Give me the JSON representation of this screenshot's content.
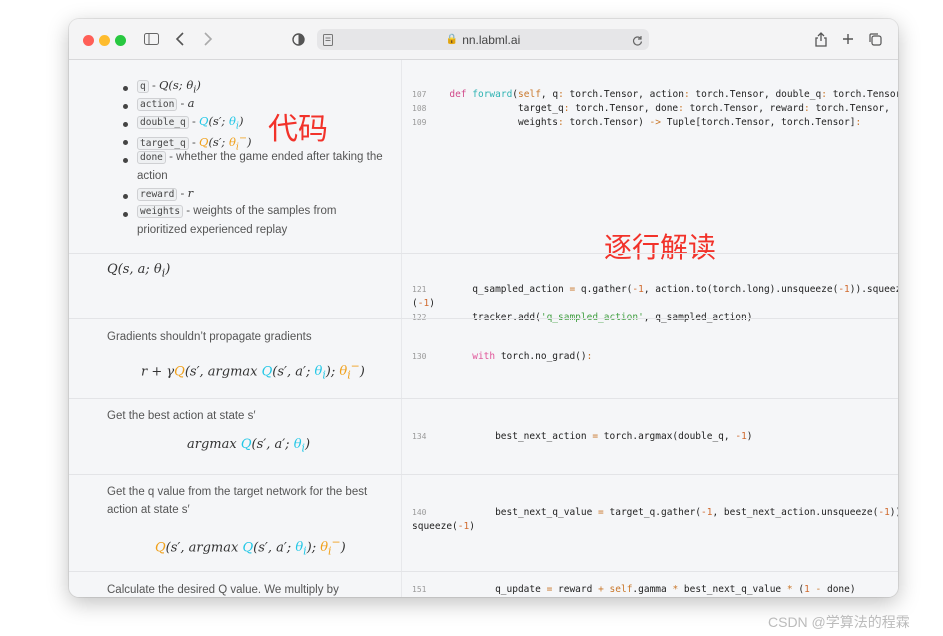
{
  "browser": {
    "url": "nn.labml.ai"
  },
  "annotations": {
    "code_label": "代码",
    "line_by_line": "逐行解读"
  },
  "watermark": "CSDN @学算法的程霖",
  "bullets": {
    "q": {
      "tag": "q",
      "desc": "Q(s; θi)"
    },
    "action": {
      "tag": "action",
      "desc": "a"
    },
    "double_q": {
      "tag": "double_q",
      "desc": "Q(s′; θi)"
    },
    "target_q": {
      "tag": "target_q",
      "desc": "Q(s′; θi−)"
    },
    "done": {
      "tag": "done",
      "desc1": " - whether the game ended after taking the",
      "desc2": "action"
    },
    "reward": {
      "tag": "reward",
      "desc": "r"
    },
    "weights": {
      "tag": "weights",
      "desc1": " - weights of the samples from",
      "desc2": "prioritized experienced replay"
    }
  },
  "sections": {
    "s2": {
      "math": "Q(s, a; θi)"
    },
    "s3": {
      "text": "Gradients shouldn’t propagate gradients",
      "math": "r + γQ(s′, argmax Q(s′, a′; θi); θi−)"
    },
    "s4": {
      "text": "Get the best action at state s′",
      "math": "argmax Q(s′, a′; θi)"
    },
    "s5": {
      "text1": "Get the q value from the target network for the best",
      "text2": "action at state s′",
      "math": "Q(s′, argmax Q(s′, a′; θi); θi−)"
    },
    "s6": {
      "text": "Calculate the desired Q value. We multiply by"
    }
  },
  "code": {
    "l107": "107",
    "l108": "108",
    "l109": "109",
    "l121": "121",
    "l122": "122",
    "l130": "130",
    "l134": "134",
    "l140": "140",
    "l151": "151"
  }
}
